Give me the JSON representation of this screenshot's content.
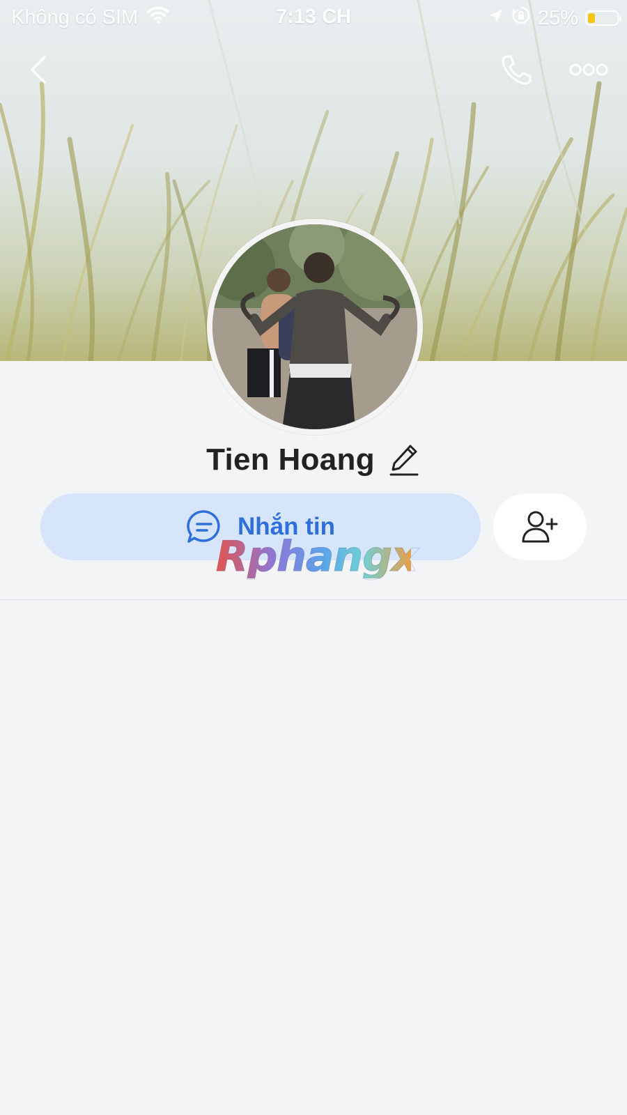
{
  "status_bar": {
    "carrier": "Không có SIM",
    "time": "7:13 CH",
    "battery_percent": "25%",
    "battery_level": 0.25
  },
  "nav": {
    "back_icon": "chevron-left-icon",
    "call_icon": "phone-icon",
    "more_icon": "more-dots-icon"
  },
  "profile": {
    "name": "Tien Hoang",
    "edit_icon": "pencil-icon"
  },
  "actions": {
    "message_label": "Nhắn tin",
    "message_icon": "chat-bubble-icon",
    "add_friend_icon": "add-user-icon"
  },
  "watermark": "Rphangx",
  "colors": {
    "message_bg": "#d7e5fb",
    "message_text": "#2f6fd8",
    "page_bg": "#f3f4f6",
    "battery": "#f5c518"
  }
}
